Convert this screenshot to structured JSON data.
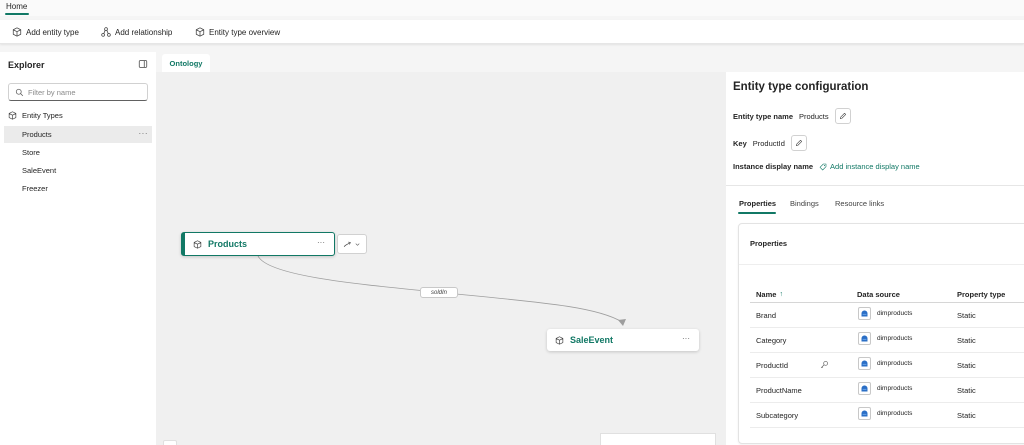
{
  "tabstrip": {
    "home_label": "Home"
  },
  "toolbar": {
    "add_entity_type": "Add entity type",
    "add_relationship": "Add relationship",
    "entity_type_overview": "Entity type overview"
  },
  "explorer": {
    "title": "Explorer",
    "search_placeholder": "Filter by name",
    "group_label": "Entity Types",
    "items": [
      {
        "label": "Products",
        "selected": true
      },
      {
        "label": "Store",
        "selected": false
      },
      {
        "label": "SaleEvent",
        "selected": false
      },
      {
        "label": "Freezer",
        "selected": false
      }
    ],
    "more_label": "···"
  },
  "canvas": {
    "tab_label": "Ontology",
    "nodes": [
      {
        "label": "Products",
        "more": "···"
      },
      {
        "label": "SaleEvent",
        "more": "···"
      }
    ],
    "edge_label": "soldIn",
    "accent_color": "#117865"
  },
  "config": {
    "title": "Entity type configuration",
    "entity_type_name_label": "Entity type name",
    "entity_type_name_value": "Products",
    "key_label": "Key",
    "key_value": "ProductId",
    "instance_display_name_label": "Instance display name",
    "add_instance_display_name": "Add instance display name",
    "tabs": [
      {
        "label": "Properties",
        "active": true
      },
      {
        "label": "Bindings",
        "active": false
      },
      {
        "label": "Resource links",
        "active": false
      }
    ],
    "properties": {
      "title": "Properties",
      "columns": {
        "name": "Name",
        "sort_indicator": "↑",
        "data_source": "Data source",
        "property_type": "Property type"
      },
      "rows": [
        {
          "name": "Brand",
          "is_key": false,
          "data_source": "dimproducts",
          "property_type": "Static"
        },
        {
          "name": "Category",
          "is_key": false,
          "data_source": "dimproducts",
          "property_type": "Static"
        },
        {
          "name": "ProductId",
          "is_key": true,
          "data_source": "dimproducts",
          "property_type": "Static"
        },
        {
          "name": "ProductName",
          "is_key": false,
          "data_source": "dimproducts",
          "property_type": "Static"
        },
        {
          "name": "Subcategory",
          "is_key": false,
          "data_source": "dimproducts",
          "property_type": "Static"
        }
      ]
    }
  },
  "icons": {
    "entity": "cube-icon",
    "relationship": "relationship-icon",
    "overview": "cube-icon",
    "edit": "pencil-icon",
    "key": "key-icon",
    "tag": "tag-icon",
    "datasource": "lakehouse-icon"
  }
}
